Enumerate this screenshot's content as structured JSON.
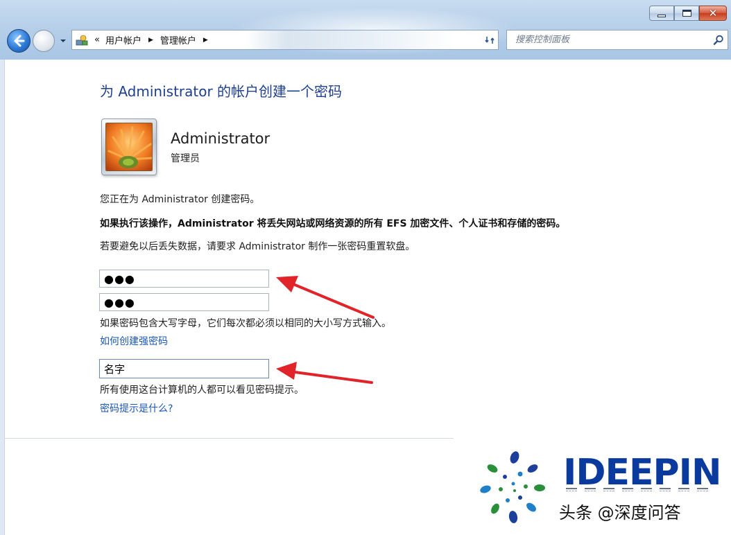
{
  "window": {
    "minimize_glyph": "",
    "maximize_glyph": "",
    "close_glyph": "✕"
  },
  "address": {
    "lead": "«",
    "crumbs": [
      "用户帐户",
      "管理帐户"
    ],
    "sep": "▶"
  },
  "search": {
    "placeholder": "搜索控制面板"
  },
  "page": {
    "title": "为 Administrator 的帐户创建一个密码",
    "user_name": "Administrator",
    "user_role": "管理员",
    "info_1": "您正在为 Administrator 创建密码。",
    "info_2": "如果执行该操作，Administrator 将丢失网站或网络资源的所有 EFS 加密文件、个人证书和存储的密码。",
    "info_3": "若要避免以后丢失数据，请要求 Administrator 制作一张密码重置软盘。",
    "password_value": "●●●",
    "confirm_value": "●●●",
    "case_note": "如果密码包含大写字母，它们每次都必须以相同的大小写方式输入。",
    "strong_pwd_link": "如何创建强密码",
    "hint_value": "名字",
    "hint_note": "所有使用这台计算机的人都可以看见密码提示。",
    "hint_link": "密码提示是什么?"
  },
  "annotation": {
    "arrow_color": "#e0242a"
  },
  "watermark": {
    "brand": "IDEEPIN",
    "caption": "头条 @深度问答",
    "brand_color": "#0b3a9e"
  }
}
